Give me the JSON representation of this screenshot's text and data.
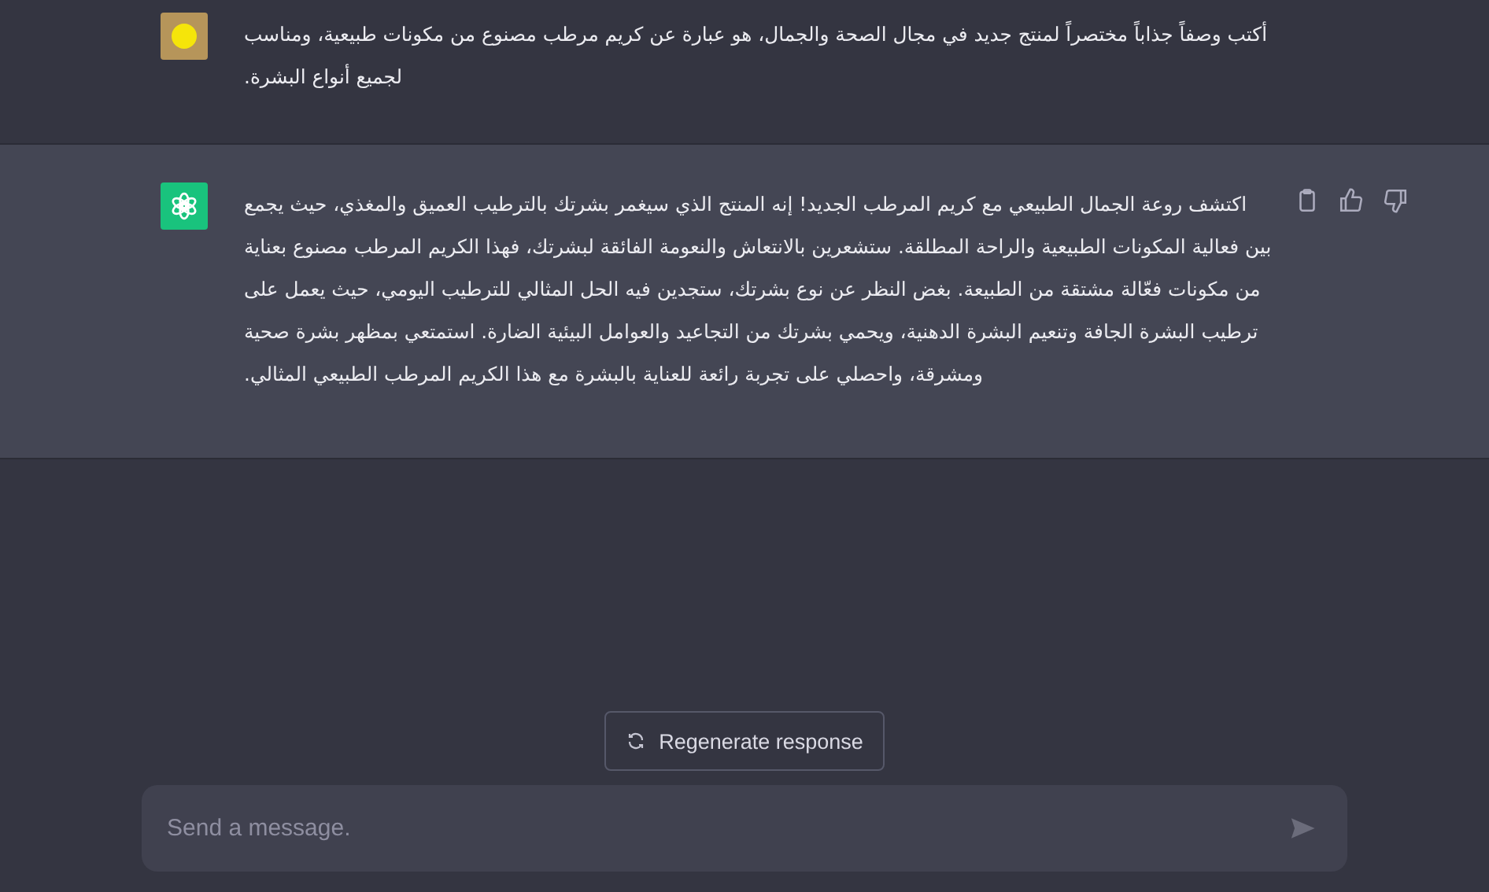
{
  "messages": [
    {
      "kind": "user",
      "text": "أكتب وصفاً جذاباً مختصراً لمنتج جديد في مجال الصحة والجمال، هو عبارة عن كريم مرطب مصنوع من مكونات طبيعية، ومناسب لجميع أنواع البشرة."
    },
    {
      "kind": "assistant",
      "text": "اكتشف روعة الجمال الطبيعي مع كريم المرطب الجديد! إنه المنتج الذي سيغمر بشرتك بالترطيب العميق والمغذي، حيث يجمع بين فعالية المكونات الطبيعية والراحة المطلقة. ستشعرين بالانتعاش والنعومة الفائقة لبشرتك، فهذا الكريم المرطب مصنوع بعناية من مكونات فعّالة مشتقة من الطبيعة. بغض النظر عن نوع بشرتك، ستجدين فيه الحل المثالي للترطيب اليومي، حيث يعمل على ترطيب البشرة الجافة وتنعيم البشرة الدهنية، ويحمي بشرتك من التجاعيد والعوامل البيئية الضارة. استمتعي بمظهر بشرة صحية ومشرقة، واحصلي على تجربة رائعة للعناية بالبشرة مع هذا الكريم المرطب الطبيعي المثالي."
    }
  ],
  "regenerate_button": {
    "label": "Regenerate response"
  },
  "composer": {
    "placeholder": "Send a message."
  }
}
